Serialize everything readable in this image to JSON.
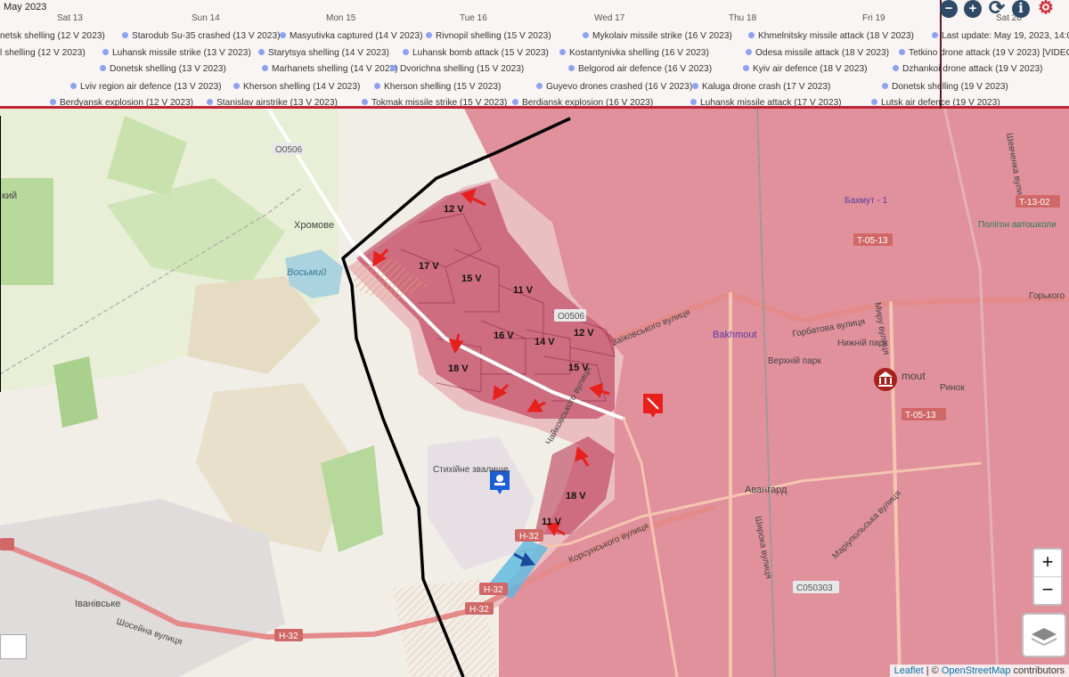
{
  "timeline": {
    "month": "May 2023",
    "days": [
      "Sat 13",
      "Sun 14",
      "Mon 15",
      "Tue 16",
      "Wed 17",
      "Thu 18",
      "Fri 19",
      "Sat 20"
    ],
    "events_row1": [
      "netsk shelling (12 V 2023)",
      "Starodub Su-35 crashed (13 V 2023)",
      "Masyutivka captured (14 V 2023)",
      "Rivnopil shelling (15 V 2023)",
      "Mykolaiv missile strike (16 V 2023)",
      "Khmelnitsky missile attack (18 V 2023)",
      "Last update: May 19, 2023, 14:00"
    ],
    "events_row2": [
      "l shelling (12 V 2023)",
      "Luhansk missile strike (13 V 2023)",
      "Starytsya shelling (14 V 2023)",
      "Luhansk bomb attack (15 V 2023)",
      "Kostantynivka shelling (16 V 2023)",
      "Odesa missile attack (18 V 2023)",
      "Tetkino drone attack (19 V 2023) [VIDEO]"
    ],
    "events_row3": [
      "Donetsk shelling (13 V 2023)",
      "Marhanets shelling (14 V 2023)",
      "Dvorichna shelling (15 V 2023)",
      "Belgorod air defence (16 V 2023)",
      "Kyiv air defence (18 V 2023)",
      "Dzhankoi drone attack (19 V 2023)"
    ],
    "events_row4": [
      "Lviv region air defence (13 V 2023)",
      "Kherson shelling (14 V 2023)",
      "Kherson shelling (15 V 2023)",
      "Guyevo drones crashed (16 V 2023)",
      "Kaluga drone crash (17 V 2023)",
      "Donetsk shelling (19 V 2023)"
    ],
    "events_row5": [
      "Berdyansk explosion (12 V 2023)",
      "Stanislav airstrike (13 V 2023)",
      "Tokmak missile strike (15 V 2023)",
      "Berdiansk explosion (16 V 2023)",
      "Luhansk missile attack (17 V 2023)",
      "Lutsk air defence (19 V 2023)"
    ]
  },
  "controls": {
    "zoom_out_tl": "−",
    "zoom_in_tl": "+",
    "info": "i",
    "zoom_in": "+",
    "zoom_out": "−"
  },
  "map_labels": {
    "khromove": "Хромове",
    "vosmyi": "Восьмий",
    "bakhmut_en": "Bakhmout",
    "bakhmut_1": "Бахмут - 1",
    "poligon": "Полігон автошколи",
    "verkhnii_park": "Верхній парк",
    "nyzhnii_park": "Нижній парк",
    "rynok": "Ринок",
    "stykhiyne": "Стихійне звалище",
    "avanhard": "Авангард",
    "ivanivske": "Іванівське",
    "shoseina": "Шосейна вулиця",
    "zaikovskoho": "Заїковського вулиця",
    "horbatova": "Горбатова вулиця",
    "myru": "Миру вулиця",
    "shevchenka": "Шевченка вулиця",
    "korsunskoho": "Корсунського вулиця",
    "shyroka": "Широка вулиця",
    "mariupolska": "Маріупольська вулиця",
    "chaikovskoho": "Чайковського вулиця",
    "horkoho": "Горького",
    "road_h32": "H-32",
    "road_o0506": "O0506",
    "road_t0513": "T-05-13",
    "road_t1302": "T-13-02",
    "road_c050303": "C050303",
    "road_o0506b": "O0506",
    "mout": "mout",
    "partial_left": "кий"
  },
  "sector_labels": [
    "12 V",
    "17 V",
    "15 V",
    "11 V",
    "16 V",
    "14 V",
    "12 V",
    "18 V",
    "15 V",
    "18 V",
    "11 V"
  ],
  "attribution": {
    "leaflet": "Leaflet",
    "sep": " | © ",
    "osm": "OpenStreetMap",
    "contrib": " contributors"
  },
  "colors": {
    "occupied": "#d2465c",
    "contested": "#e6a0a8",
    "frontline": "#000000",
    "arrow": "#e8201c",
    "timeline_dot": "#8ea3f0",
    "border_line": "#c22435"
  }
}
